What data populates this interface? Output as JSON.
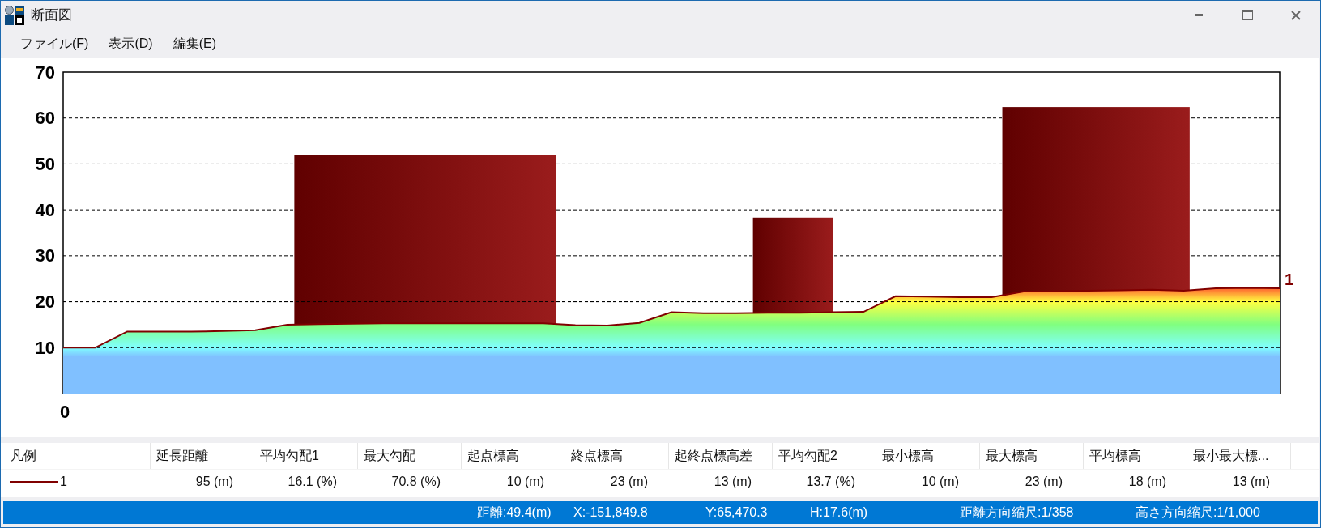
{
  "window": {
    "title": "断面図"
  },
  "menu": [
    "ファイル(F)",
    "表示(D)",
    "編集(E)"
  ],
  "chart": {
    "origin_label": "0",
    "chart_data": {
      "type": "area",
      "grid": true,
      "ylim": [
        0,
        70
      ],
      "yticks": [
        10,
        20,
        30,
        40,
        50,
        60,
        70
      ],
      "categories": [
        null,
        null,
        null,
        null,
        null,
        null,
        null,
        null,
        null,
        null,
        null,
        null,
        null,
        null,
        null,
        null,
        null,
        null,
        null,
        null,
        null,
        null,
        null,
        null,
        null,
        null,
        null,
        null,
        null,
        null,
        null,
        null,
        null,
        null,
        null,
        null,
        null,
        null,
        null
      ],
      "series": [
        {
          "name": "1",
          "color": "#800000",
          "values": [
            10,
            10,
            13.5,
            13.5,
            13.5,
            13.6,
            13.8,
            15,
            15.1,
            15.2,
            15.3,
            15.3,
            15.3,
            15.3,
            15.3,
            15.3,
            14.9,
            14.8,
            15.4,
            17.7,
            17.5,
            17.5,
            17.6,
            17.6,
            17.7,
            17.8,
            21.2,
            21.1,
            21,
            21,
            22.2,
            22.3,
            22.4,
            22.5,
            22.6,
            22.4,
            22.9,
            23,
            22.9
          ]
        }
      ]
    }
  },
  "legend_table": {
    "columns": [
      "凡例",
      "延長距離",
      "平均勾配1",
      "最大勾配",
      "起点標高",
      "終点標高",
      "起終点標高差",
      "平均勾配2",
      "最小標高",
      "最大標高",
      "平均標高",
      "最小最大標..."
    ],
    "rows": [
      {
        "color": "#800000",
        "cells": [
          "1",
          "95 (m)",
          "16.1 (%)",
          "70.8 (%)",
          "10 (m)",
          "23 (m)",
          "13 (m)",
          "13.7 (%)",
          "10 (m)",
          "23 (m)",
          "18 (m)",
          "13 (m)"
        ]
      }
    ]
  },
  "status_bar": [
    "距離:49.4(m)",
    "X:-151,849.8",
    "Y:65,470.3",
    "H:17.6(m)",
    "距離方向縮尺:1/358",
    "高さ方向縮尺:1/1,000"
  ]
}
